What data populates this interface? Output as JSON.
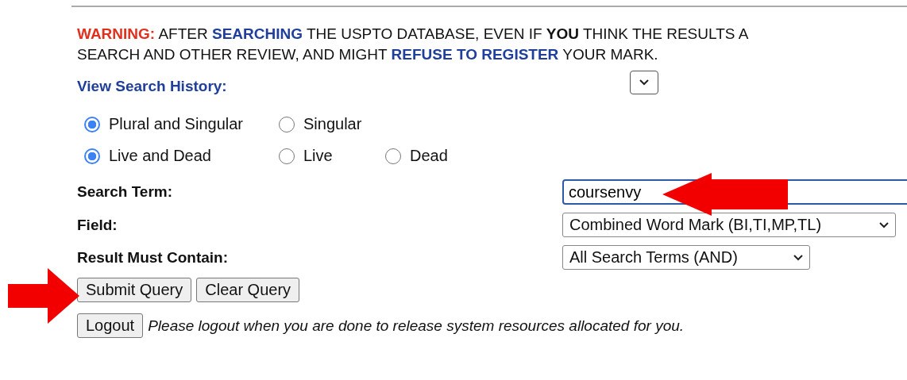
{
  "warning": [
    {
      "kind": "alert",
      "text": "WARNING:"
    },
    {
      "kind": "plain",
      "text": "AFTER"
    },
    {
      "kind": "link",
      "text": "SEARCHING"
    },
    {
      "kind": "plain",
      "text": "THE USPTO DATABASE, EVEN IF"
    },
    {
      "kind": "strong",
      "text": "YOU"
    },
    {
      "kind": "plain",
      "text": "THINK THE RESULTS A"
    }
  ],
  "warning_line2": [
    {
      "kind": "plain",
      "text": "SEARCH AND OTHER REVIEW, AND MIGHT"
    },
    {
      "kind": "link",
      "text": "REFUSE TO REGISTER"
    },
    {
      "kind": "plain",
      "text": "YOUR MARK."
    }
  ],
  "history": {
    "label": "View Search History:"
  },
  "plurality": [
    {
      "label": "Plural and Singular",
      "selected": true
    },
    {
      "label": "Singular",
      "selected": false
    }
  ],
  "status": [
    {
      "label": "Live and Dead",
      "selected": true
    },
    {
      "label": "Live",
      "selected": false
    },
    {
      "label": "Dead",
      "selected": false
    }
  ],
  "search_term": {
    "label": "Search Term:",
    "value": "coursenvy",
    "focused": true
  },
  "field": {
    "label": "Field:",
    "value": "Combined Word Mark (BI,TI,MP,TL)"
  },
  "result": {
    "label": "Result Must Contain:",
    "value": "All Search Terms (AND)"
  },
  "buttons": [
    "Submit Query",
    "Clear Query"
  ],
  "logout": {
    "button": "Logout",
    "note": "Please logout when you are done to release system resources allocated for you."
  }
}
